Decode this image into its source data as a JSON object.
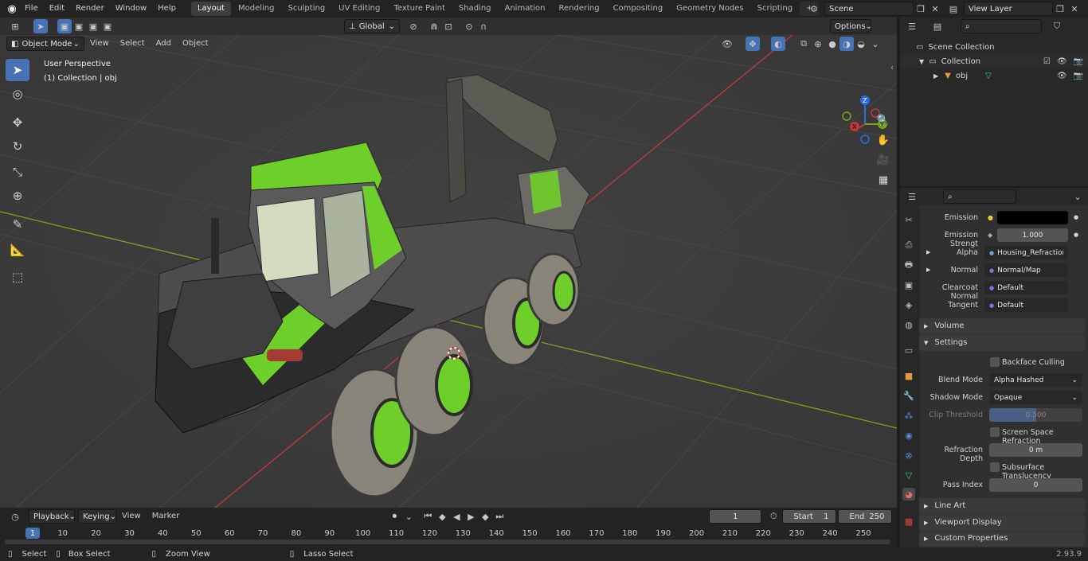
{
  "menu": {
    "items": [
      "File",
      "Edit",
      "Render",
      "Window",
      "Help"
    ],
    "workspaces": [
      "Layout",
      "Modeling",
      "Sculpting",
      "UV Editing",
      "Texture Paint",
      "Shading",
      "Animation",
      "Rendering",
      "Compositing",
      "Geometry Nodes",
      "Scripting"
    ],
    "active_workspace": "Layout",
    "add_tab": "+",
    "scene_name": "Scene",
    "view_layer": "View Layer"
  },
  "viewport_header": {
    "orientation": "Global",
    "options_label": "Options",
    "mode": "Object Mode",
    "menus": [
      "View",
      "Select",
      "Add",
      "Object"
    ]
  },
  "viewport": {
    "perspective_label": "User Perspective",
    "collection_label": "(1) Collection | obj",
    "gizmo": {
      "z": "Z",
      "y": "Y",
      "x": "X"
    },
    "floor_color": "#3c3c3c",
    "grid_color": "#474747",
    "x_axis_color": "#c0393b",
    "y_axis_color": "#7aa51c",
    "model_green": "#6fcf2a"
  },
  "outliner": {
    "scene_collection": "Scene Collection",
    "collection": "Collection",
    "object": "obj"
  },
  "properties": {
    "emission_label": "Emission",
    "emission_strength_label": "Emission Strengt",
    "emission_strength_value": "1.000",
    "alpha_label": "Alpha",
    "alpha_value": "Housing_Refraction_...",
    "normal_label": "Normal",
    "normal_value": "Normal/Map",
    "clearcoat_normal_label": "Clearcoat Normal",
    "clearcoat_normal_value": "Default",
    "tangent_label": "Tangent",
    "tangent_value": "Default",
    "volume_section": "Volume",
    "settings_section": "Settings",
    "backface_culling": "Backface Culling",
    "blend_mode_label": "Blend Mode",
    "blend_mode_value": "Alpha Hashed",
    "shadow_mode_label": "Shadow Mode",
    "shadow_mode_value": "Opaque",
    "clip_threshold_label": "Clip Threshold",
    "clip_threshold_value": "0.500",
    "screen_space_refraction": "Screen Space Refraction",
    "refraction_depth_label": "Refraction Depth",
    "refraction_depth_value": "0 m",
    "subsurface_translucency": "Subsurface Translucency",
    "pass_index_label": "Pass Index",
    "pass_index_value": "0",
    "line_art_section": "Line Art",
    "viewport_display_section": "Viewport Display",
    "custom_properties_section": "Custom Properties"
  },
  "timeline": {
    "menus": [
      "Playback",
      "Keying",
      "View",
      "Marker"
    ],
    "current_frame": "1",
    "start_label": "Start",
    "start_value": "1",
    "end_label": "End",
    "end_value": "250",
    "ticks": [
      "1",
      "10",
      "20",
      "30",
      "40",
      "50",
      "60",
      "70",
      "80",
      "90",
      "100",
      "110",
      "120",
      "130",
      "140",
      "150",
      "160",
      "170",
      "180",
      "190",
      "200",
      "210",
      "220",
      "230",
      "240",
      "250"
    ]
  },
  "statusbar": {
    "select": "Select",
    "box_select": "Box Select",
    "zoom_view": "Zoom View",
    "lasso_select": "Lasso Select",
    "version": "2.93.9"
  }
}
